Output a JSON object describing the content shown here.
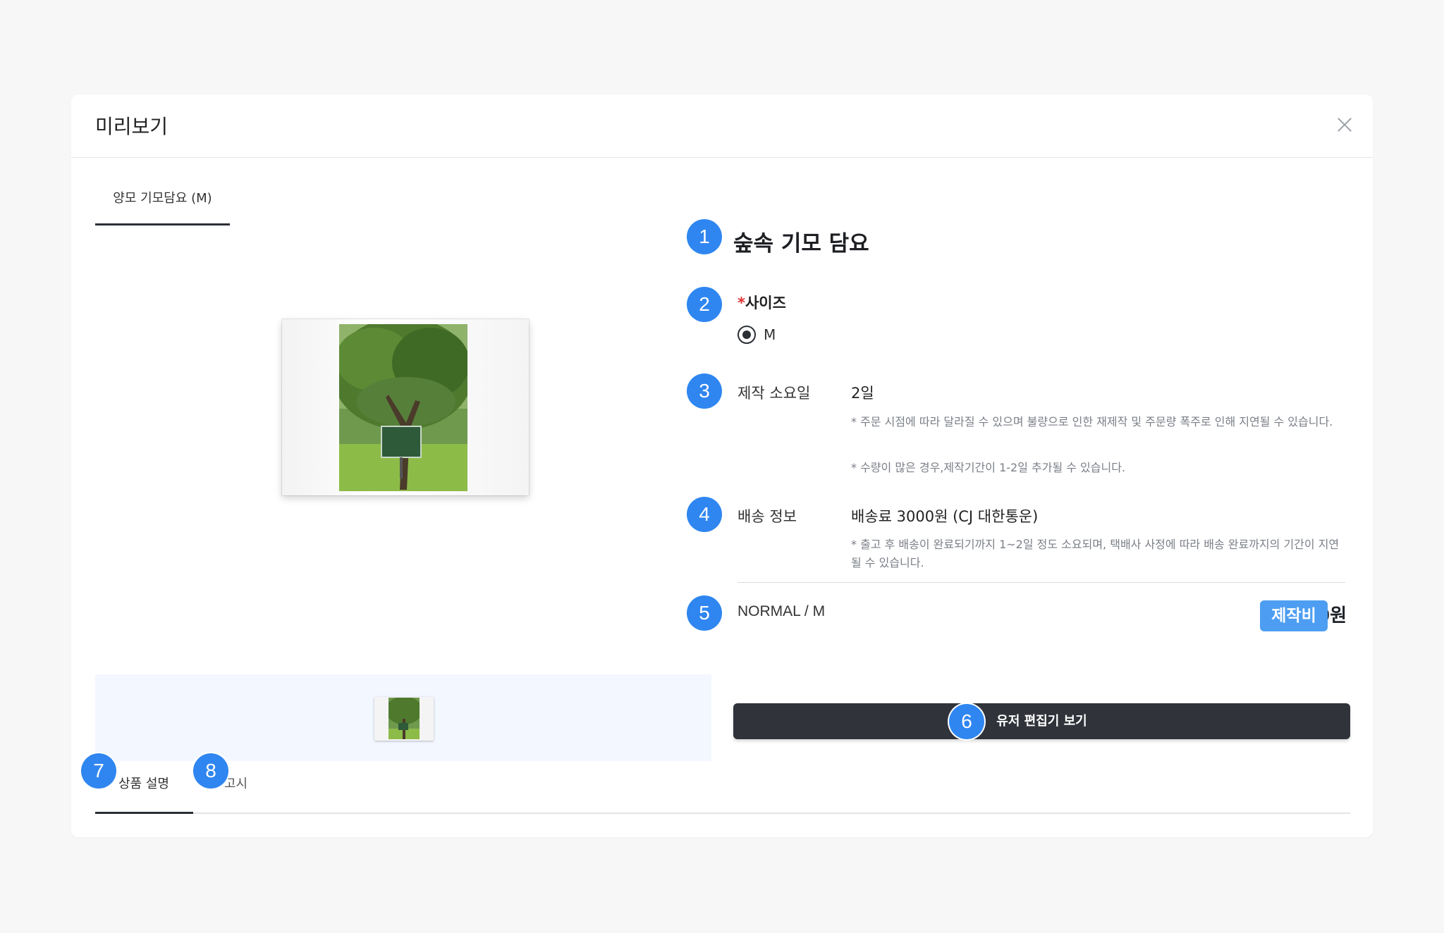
{
  "modal": {
    "title": "미리보기",
    "close_icon": "close-icon"
  },
  "image_tab": {
    "label": "양모 기모담요 (M)"
  },
  "product": {
    "name": "숲속 기모 담요",
    "size": {
      "required_mark": "*",
      "label": "사이즈",
      "options": [
        "M"
      ],
      "selected": "M"
    },
    "production": {
      "label": "제작 소요일",
      "value": "2일",
      "notes": [
        "* 주문 시점에 따라 달라질 수 있으며 불량으로 인한 재제작 및 주문량 폭주로 인해 지연될 수 있습니다.",
        "* 수량이 많은 경우,제작기간이 1-2일 추가될 수 있습니다."
      ]
    },
    "shipping": {
      "label": "배송 정보",
      "value": "배송료 3000원 (CJ 대한통운)",
      "note": "* 출고 후 배송이 완료되기까지 1~2일 정도 소요되며, 택배사 사정에 따라 배송 완료까지의 기간이 지연될 수 있습니다."
    },
    "option": {
      "name": "NORMAL / M",
      "price_text": "0원",
      "price_chip": "제작비"
    }
  },
  "editor_button": {
    "label": "유저 편집기 보기"
  },
  "bottom_tabs": [
    {
      "label": "상품 설명",
      "active": true
    },
    {
      "label": "고시",
      "active": false
    }
  ],
  "markers": [
    "1",
    "2",
    "3",
    "4",
    "5",
    "6",
    "7",
    "8"
  ],
  "colors": {
    "accent": "#2f86f0",
    "dark_button": "#30333a",
    "chip": "#4d9ef2",
    "required": "#e03131"
  }
}
